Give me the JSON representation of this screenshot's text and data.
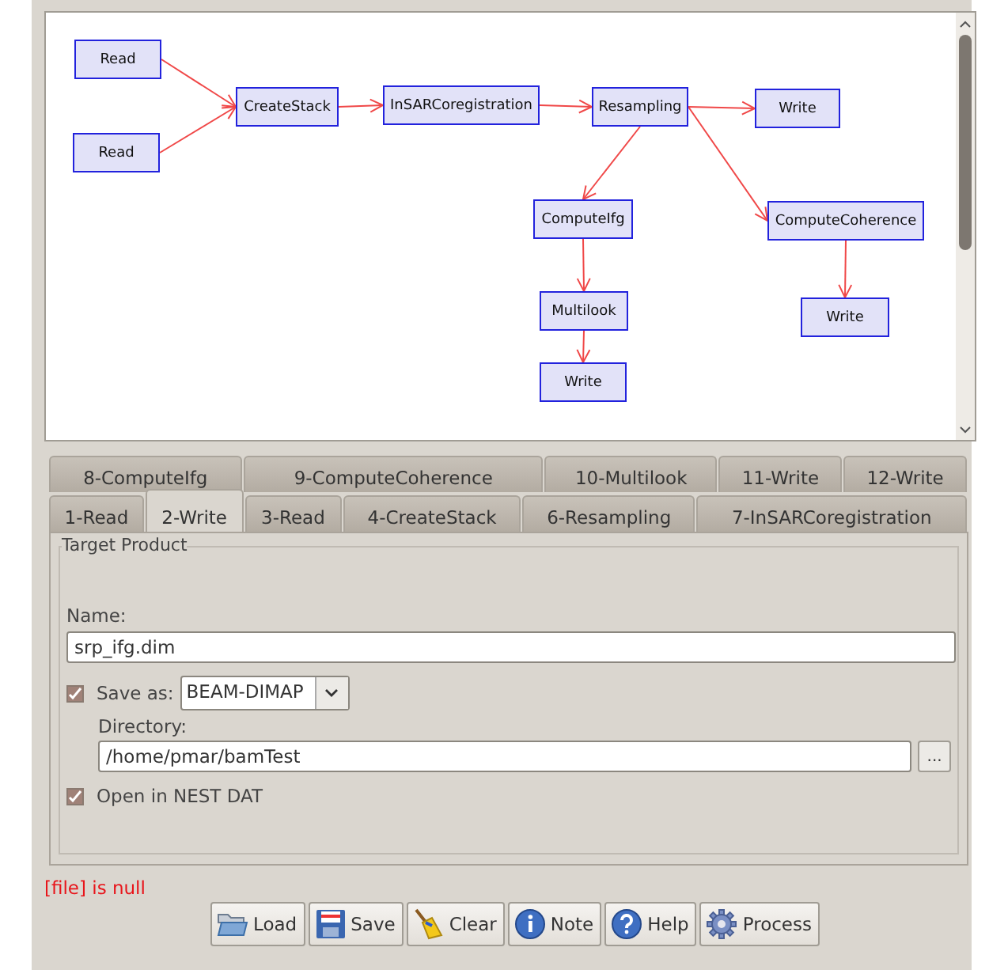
{
  "graph": {
    "nodes": [
      {
        "label": "Read"
      },
      {
        "label": "Read"
      },
      {
        "label": "CreateStack"
      },
      {
        "label": "InSARCoregistration"
      },
      {
        "label": "Resampling"
      },
      {
        "label": "Write"
      },
      {
        "label": "ComputeIfg"
      },
      {
        "label": "ComputeCoherence"
      },
      {
        "label": "Multilook"
      },
      {
        "label": "Write"
      },
      {
        "label": "Write"
      }
    ]
  },
  "tab_rows": [
    [
      {
        "label": "8-ComputeIfg",
        "selected": false
      },
      {
        "label": "9-ComputeCoherence",
        "selected": false
      },
      {
        "label": "10-Multilook",
        "selected": false
      },
      {
        "label": "11-Write",
        "selected": false
      },
      {
        "label": "12-Write",
        "selected": false
      }
    ],
    [
      {
        "label": "1-Read",
        "selected": false
      },
      {
        "label": "2-Write",
        "selected": true
      },
      {
        "label": "3-Read",
        "selected": false
      },
      {
        "label": "4-CreateStack",
        "selected": false
      },
      {
        "label": "6-Resampling",
        "selected": false
      },
      {
        "label": "7-InSARCoregistration",
        "selected": false
      }
    ]
  ],
  "target_product": {
    "title": "Target Product",
    "name_label": "Name:",
    "name_value": "srp_ifg.dim",
    "save_as": {
      "label": "Save as:",
      "checked": true,
      "format": "BEAM-DIMAP"
    },
    "directory_label": "Directory:",
    "directory_value": "/home/pmar/bamTest",
    "browse": "...",
    "open_in_dat": {
      "label": "Open in NEST DAT",
      "checked": true
    }
  },
  "error": "[file] is null",
  "buttons": [
    {
      "kind": "load",
      "label": "Load"
    },
    {
      "kind": "save",
      "label": "Save"
    },
    {
      "kind": "clear",
      "label": "Clear"
    },
    {
      "kind": "note",
      "label": "Note"
    },
    {
      "kind": "help",
      "label": "Help"
    },
    {
      "kind": "process",
      "label": "Process"
    }
  ]
}
